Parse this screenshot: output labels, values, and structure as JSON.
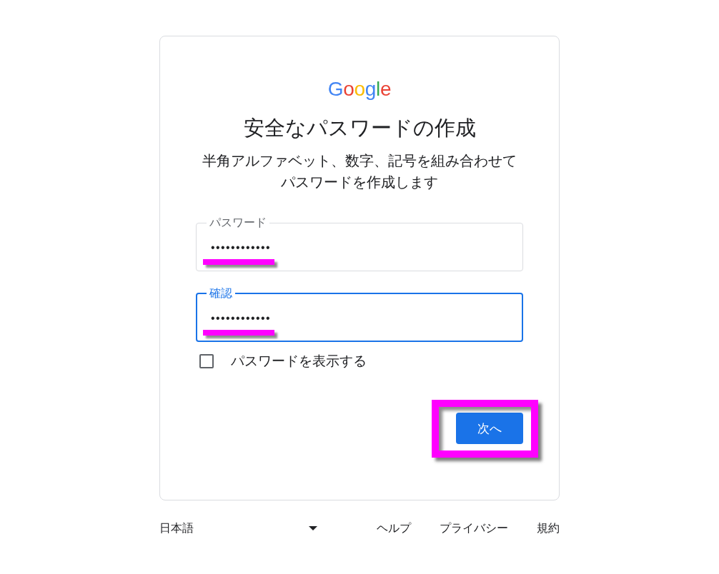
{
  "logo": {
    "text": "Google"
  },
  "heading": "安全なパスワードの作成",
  "description": "半角アルファベット、数字、記号を組み合わせてパスワードを作成します",
  "fields": [
    {
      "label": "パスワード",
      "value": "••••••••••••",
      "focused": false,
      "highlighted": true
    },
    {
      "label": "確認",
      "value": "••••••••••••",
      "focused": true,
      "highlighted": true
    }
  ],
  "show_password": {
    "label": "パスワードを表示する",
    "checked": false
  },
  "next_button": {
    "label": "次へ",
    "highlighted": true
  },
  "footer": {
    "language": {
      "label": "日本語"
    },
    "links": [
      {
        "label": "ヘルプ"
      },
      {
        "label": "プライバシー"
      },
      {
        "label": "規約"
      }
    ]
  }
}
